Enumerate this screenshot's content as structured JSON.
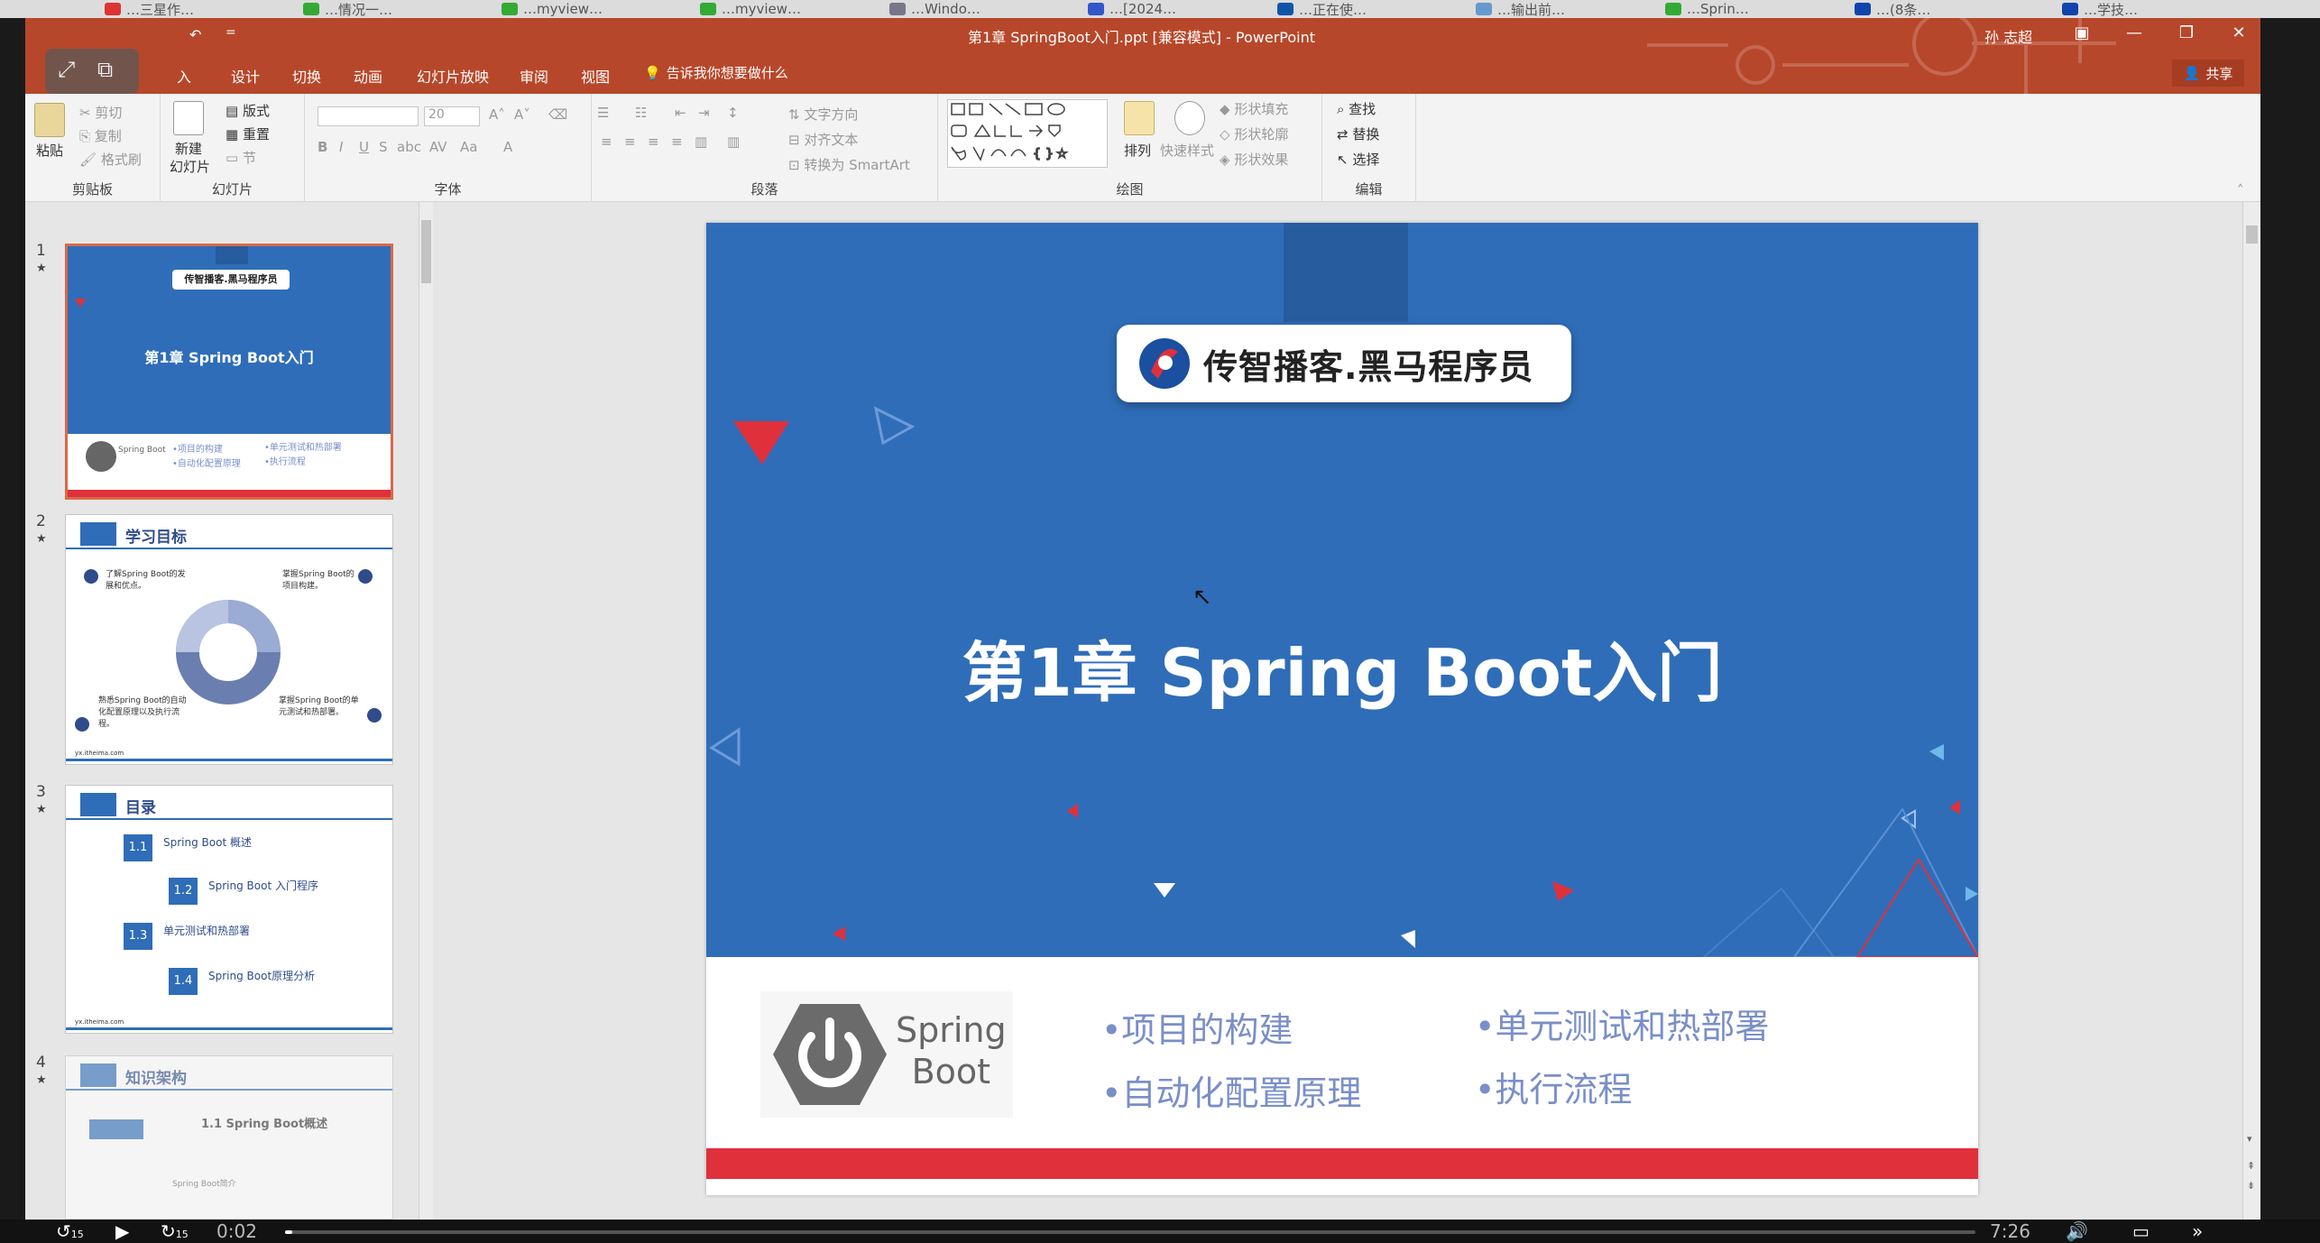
{
  "browser_tabs": [
    {
      "label": "…三星作…",
      "color": "#d33"
    },
    {
      "label": "…情况一…",
      "color": "#3a3"
    },
    {
      "label": "…myview…",
      "color": "#3a3"
    },
    {
      "label": "…myview…",
      "color": "#3a3"
    },
    {
      "label": "…Windo…",
      "color": "#778"
    },
    {
      "label": "…[2024…",
      "color": "#35c"
    },
    {
      "label": "…正在使…",
      "color": "#15a"
    },
    {
      "label": "…输出前…",
      "color": "#69c"
    },
    {
      "label": "…Sprin…",
      "color": "#3a3"
    },
    {
      "label": "…(8条…",
      "color": "#14a"
    },
    {
      "label": "…学技…",
      "color": "#14a"
    }
  ],
  "window": {
    "title": "第1章 SpringBoot入门.ppt [兼容模式] - PowerPoint",
    "user": "孙 志超",
    "share_label": "共享",
    "undo_icon": "undo-icon",
    "qat_more": "="
  },
  "menu": {
    "items": [
      "入",
      "设计",
      "切换",
      "动画",
      "幻灯片放映",
      "审阅",
      "视图"
    ],
    "tell_me": "告诉我你想要做什么"
  },
  "ribbon": {
    "clipboard": {
      "label": "剪贴板",
      "paste": "粘贴",
      "cut": "剪切",
      "copy": "复制",
      "format_painter": "格式刷"
    },
    "slides": {
      "label": "幻灯片",
      "new_slide_1": "新建",
      "new_slide_2": "幻灯片",
      "layout": "版式",
      "reset": "重置",
      "section": "节"
    },
    "font": {
      "label": "字体",
      "font_size": "20"
    },
    "paragraph": {
      "label": "段落",
      "text_direction": "文字方向",
      "align_text": "对齐文本",
      "smartart": "转换为 SmartArt"
    },
    "drawing": {
      "label": "绘图",
      "arrange": "排列",
      "quick_styles": "快速样式",
      "shape_fill": "形状填充",
      "shape_outline": "形状轮廓",
      "shape_effects": "形状效果"
    },
    "editing": {
      "label": "编辑",
      "find": "查找",
      "replace": "替换",
      "select": "选择"
    }
  },
  "thumbnails": [
    {
      "num": "1",
      "star": "★",
      "header": "传智播客.黑马程序员",
      "title": "第1章  Spring Boot入门",
      "b1": "•项目的构建",
      "b2": "•自动化配置原理",
      "b3": "•单元测试和热部署",
      "b4": "•执行流程",
      "logo": "Spring Boot"
    },
    {
      "num": "2",
      "star": "★",
      "title": "学习目标",
      "p1": "了解Spring Boot的发展和优点。",
      "p2": "掌握Spring Boot的项目构建。",
      "p3": "熟悉Spring Boot的自动化配置原理以及执行流程。",
      "p4": "掌握Spring Boot的单元测试和热部署。",
      "footer": "yx.itheima.com"
    },
    {
      "num": "3",
      "star": "★",
      "title": "目录",
      "i1": "Spring Boot 概述",
      "i2": "Spring Boot 入门程序",
      "i3": "单元测试和热部署",
      "i4": "Spring Boot原理分析",
      "n1": "1.1",
      "n2": "1.2",
      "n3": "1.3",
      "n4": "1.4",
      "footer": "yx.itheima.com"
    },
    {
      "num": "4",
      "star": "★",
      "title": "知识架构",
      "sub": "1.1  Spring Boot概述",
      "item": "Spring Boot简介"
    }
  ],
  "slide": {
    "logo_text": "传智播客.黑马程序员",
    "title": "第1章  Spring Boot入门",
    "spring_logo_1": "Spring",
    "spring_logo_2": "Boot",
    "bullets": [
      "•项目的构建",
      "•自动化配置原理",
      "•单元测试和热部署",
      "•执行流程"
    ]
  },
  "video": {
    "elapsed": "0:02",
    "duration": "7:26",
    "progress": 0.0045,
    "rewind": "15",
    "forward": "15"
  }
}
